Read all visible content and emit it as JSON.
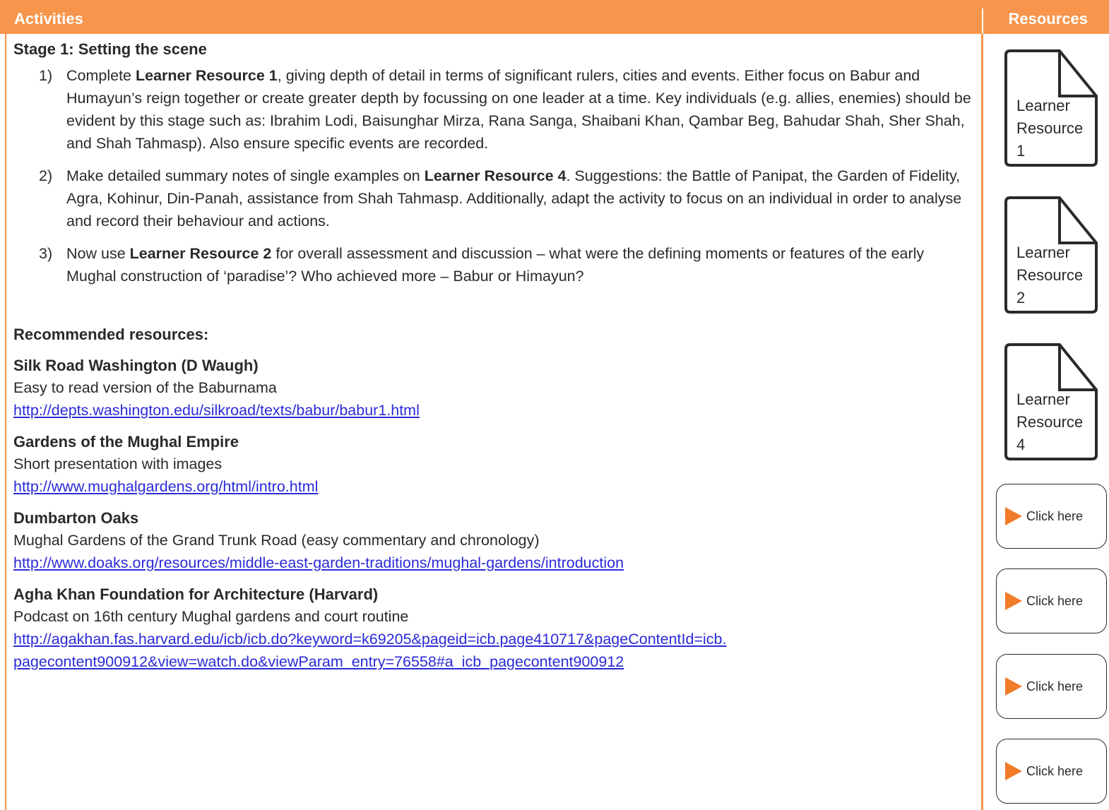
{
  "header": {
    "activities": "Activities",
    "resources": "Resources"
  },
  "stage": {
    "title": "Stage 1: Setting the scene",
    "items": [
      {
        "num": "1)",
        "pre": "Complete ",
        "bold": "Learner Resource 1",
        "post": ", giving depth of detail in terms of significant rulers, cities and events. Either focus on Babur and Humayun’s reign together or create greater depth by focussing on one leader at a time. Key individuals (e.g. allies, enemies) should be evident by this stage such as: Ibrahim Lodi, Baisunghar Mirza, Rana Sanga, Shaibani Khan, Qambar Beg, Bahudar Shah, Sher Shah, and Shah Tahmasp). Also ensure specific events are recorded."
      },
      {
        "num": "2)",
        "pre": "Make detailed summary notes of single examples on ",
        "bold": "Learner Resource 4",
        "post": ". Suggestions: the Battle of Panipat, the Garden of Fidelity, Agra, Kohinur, Din-Panah, assistance from Shah Tahmasp. Additionally, adapt the activity to focus on an individual in order to analyse and record their behaviour and actions."
      },
      {
        "num": "3)",
        "pre": "Now use ",
        "bold": "Learner Resource 2",
        "post": " for overall assessment and discussion – what were the defining moments or features of the early Mughal construction of ‘paradise’? Who achieved more – Babur or Himayun?"
      }
    ]
  },
  "recommended": {
    "title": "Recommended resources:",
    "items": [
      {
        "title": "Silk Road Washington (D Waugh)",
        "desc": "Easy to read version of the Baburnama",
        "link": "http://depts.washington.edu/silkroad/texts/babur/babur1.html"
      },
      {
        "title": "Gardens of the Mughal Empire",
        "desc": "Short presentation with images",
        "link": "http://www.mughalgardens.org/html/intro.html"
      },
      {
        "title": "Dumbarton Oaks",
        "desc": "Mughal Gardens of the Grand Trunk Road (easy commentary and chronology)",
        "link": "http://www.doaks.org/resources/middle-east-garden-traditions/mughal-gardens/introduction"
      },
      {
        "title": "Agha Khan Foundation for Architecture (Harvard)",
        "desc": "Podcast on 16th century Mughal gardens and court routine",
        "link1": "http://agakhan.fas.harvard.edu/icb/icb.do?keyword=k69205&pageid=icb.page410717&pageContentId=icb.",
        "link2": "pagecontent900912&view=watch.do&viewParam_entry=76558#a_icb_pagecontent900912"
      }
    ]
  },
  "sidebar": {
    "docs": [
      {
        "l1": "Learner",
        "l2": "Resource",
        "l3": "1"
      },
      {
        "l1": "Learner",
        "l2": "Resource",
        "l3": "2"
      },
      {
        "l1": "Learner",
        "l2": "Resource",
        "l3": "4"
      }
    ],
    "click_label": "Click here"
  },
  "colors": {
    "accent": "#f7954c",
    "play": "#f07c2a",
    "link": "#2a2ad8"
  }
}
